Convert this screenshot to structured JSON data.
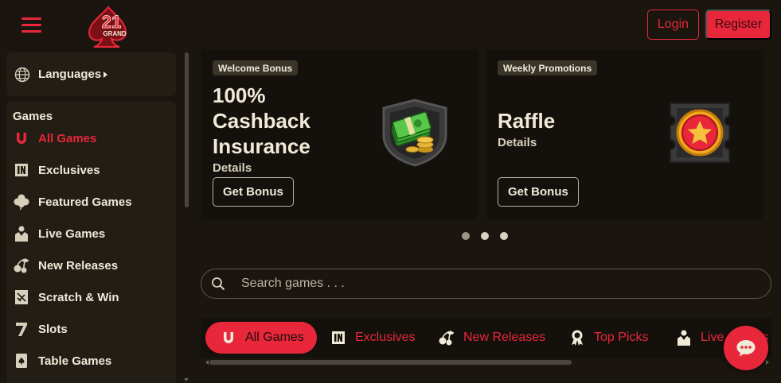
{
  "header": {
    "logo_text": "21 GRAND",
    "login_label": "Login",
    "register_label": "Register"
  },
  "sidebar": {
    "languages_label": "Languages",
    "games_title": "Games",
    "items": [
      {
        "label": "All Games",
        "icon": "horseshoe-icon",
        "active": true
      },
      {
        "label": "Exclusives",
        "icon": "in-badge-icon",
        "active": false
      },
      {
        "label": "Featured Games",
        "icon": "clover-icon",
        "active": false
      },
      {
        "label": "Live Games",
        "icon": "dealer-icon",
        "active": false
      },
      {
        "label": "New Releases",
        "icon": "cherry-icon",
        "active": false
      },
      {
        "label": "Scratch & Win",
        "icon": "ticket-icon",
        "active": false
      },
      {
        "label": "Slots",
        "icon": "seven-icon",
        "active": false
      },
      {
        "label": "Table Games",
        "icon": "card-spade-icon",
        "active": false
      }
    ]
  },
  "promos": [
    {
      "badge": "Welcome Bonus",
      "title_lines": [
        "100%",
        "Cashback",
        "Insurance"
      ],
      "details": "Details",
      "button": "Get Bonus",
      "art": "cash-shield-icon"
    },
    {
      "badge": "Weekly Promotions",
      "title_lines": [
        "Raffle"
      ],
      "details": "Details",
      "button": "Get Bonus",
      "art": "star-coin-ticket-icon"
    }
  ],
  "carousel": {
    "dots": 3,
    "active_index": 0
  },
  "search": {
    "placeholder": "Search games . . ."
  },
  "tabs": [
    {
      "label": "All Games",
      "icon": "horseshoe-icon",
      "active": true
    },
    {
      "label": "Exclusives",
      "icon": "in-badge-icon",
      "active": false
    },
    {
      "label": "New Releases",
      "icon": "cherry-icon",
      "active": false
    },
    {
      "label": "Top Picks",
      "icon": "ribbon-icon",
      "active": false
    },
    {
      "label": "Live Games",
      "icon": "dealer-icon",
      "active": false
    }
  ],
  "colors": {
    "accent": "#e8273a",
    "background": "#1a160f",
    "panel": "#221d15",
    "text": "#f1ead9"
  }
}
